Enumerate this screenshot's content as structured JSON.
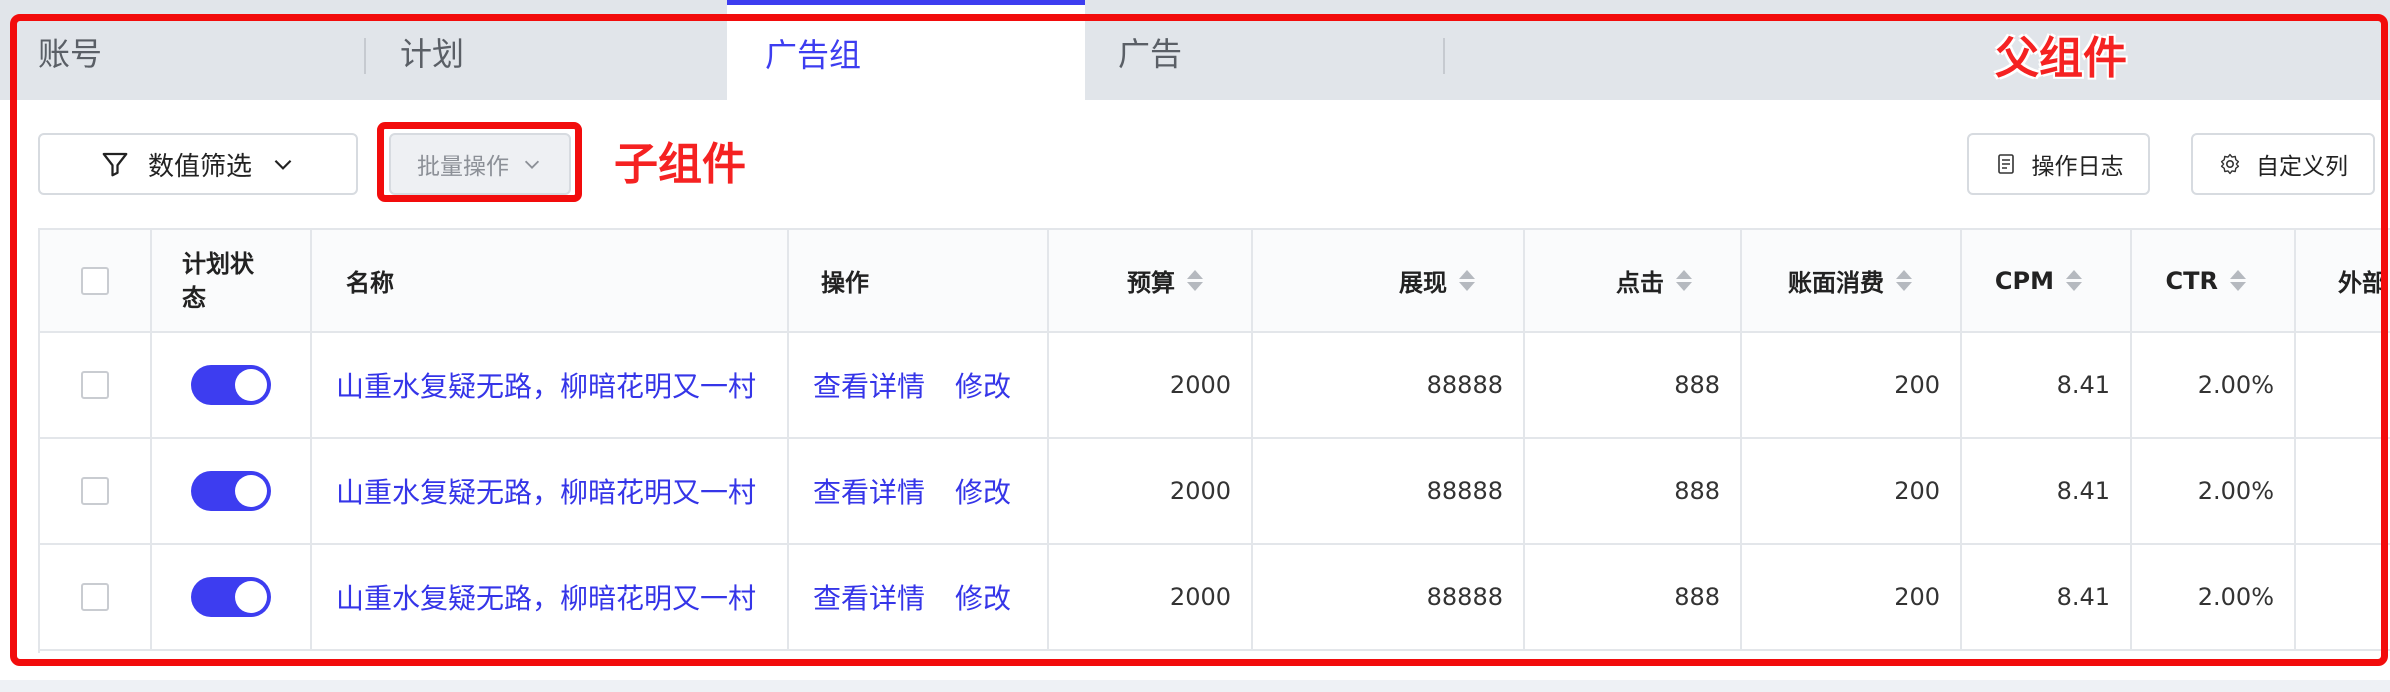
{
  "tabs": [
    {
      "label": "账号",
      "active": false
    },
    {
      "label": "计划",
      "active": false
    },
    {
      "label": "广告组",
      "active": true
    },
    {
      "label": "广告",
      "active": false
    }
  ],
  "toolbar": {
    "filter_label": "数值筛选",
    "batch_label": "批量操作",
    "log_label": "操作日志",
    "custom_columns_label": "自定义列"
  },
  "annotations": {
    "parent_label": "父组件",
    "child_label": "子组件"
  },
  "table": {
    "headers": {
      "status": "计划状态",
      "name": "名称",
      "action": "操作",
      "budget": "预算",
      "impressions": "展现",
      "clicks": "点击",
      "spend": "账面消费",
      "cpm": "CPM",
      "ctr": "CTR",
      "extra": "外部"
    },
    "rows": [
      {
        "name": "山重水复疑无路，柳暗花明又一村",
        "view": "查看详情",
        "edit": "修改",
        "budget": "2000",
        "impressions": "88888",
        "clicks": "888",
        "spend": "200",
        "cpm": "8.41",
        "ctr": "2.00%"
      },
      {
        "name": "山重水复疑无路，柳暗花明又一村",
        "view": "查看详情",
        "edit": "修改",
        "budget": "2000",
        "impressions": "88888",
        "clicks": "888",
        "spend": "200",
        "cpm": "8.41",
        "ctr": "2.00%"
      },
      {
        "name": "山重水复疑无路，柳暗花明又一村",
        "view": "查看详情",
        "edit": "修改",
        "budget": "2000",
        "impressions": "88888",
        "clicks": "888",
        "spend": "200",
        "cpm": "8.41",
        "ctr": "2.00%"
      }
    ]
  },
  "colors": {
    "accent": "#3d3df0",
    "annotation": "#f20c0c"
  }
}
